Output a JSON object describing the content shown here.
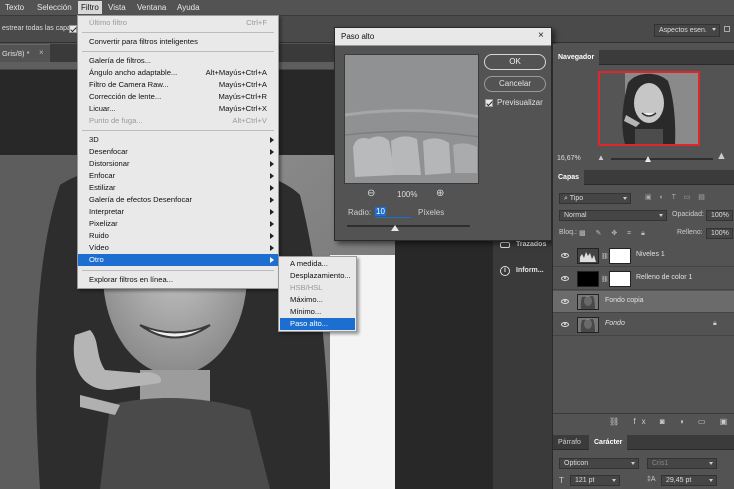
{
  "menubar": {
    "items": [
      "Texto",
      "Selección",
      "Filtro",
      "Vista",
      "Ventana",
      "Ayuda"
    ]
  },
  "options_bar": {
    "sample_all_layers": "estrear todas las capas",
    "workspace": "Aspectos esen."
  },
  "document_tab": "Gris/8) *",
  "filter_menu": {
    "items": [
      {
        "label": "Último filtro",
        "shortcut": "Ctrl+F",
        "disabled": true
      },
      {
        "label": "Convertir para filtros inteligentes",
        "shortcut": ""
      },
      {
        "label": "Galería de filtros...",
        "shortcut": ""
      },
      {
        "label": "Ángulo ancho adaptable...",
        "shortcut": "Alt+Mayús+Ctrl+A"
      },
      {
        "label": "Filtro de Camera Raw...",
        "shortcut": "Mayús+Ctrl+A"
      },
      {
        "label": "Corrección de lente...",
        "shortcut": "Mayús+Ctrl+R"
      },
      {
        "label": "Licuar...",
        "shortcut": "Mayús+Ctrl+X"
      },
      {
        "label": "Punto de fuga...",
        "shortcut": "Alt+Ctrl+V",
        "disabled": true
      },
      {
        "label": "3D"
      },
      {
        "label": "Desenfocar"
      },
      {
        "label": "Distorsionar"
      },
      {
        "label": "Enfocar"
      },
      {
        "label": "Estilizar"
      },
      {
        "label": "Galería de efectos Desenfocar"
      },
      {
        "label": "Interpretar"
      },
      {
        "label": "Pixelizar"
      },
      {
        "label": "Ruido"
      },
      {
        "label": "Vídeo"
      },
      {
        "label": "Otro"
      },
      {
        "label": "Explorar filtros en línea..."
      }
    ]
  },
  "submenu_otro": {
    "items": [
      {
        "label": "A medida..."
      },
      {
        "label": "Desplazamiento..."
      },
      {
        "label": "HSB/HSL",
        "disabled": true
      },
      {
        "label": "Máximo..."
      },
      {
        "label": "Mínimo..."
      },
      {
        "label": "Paso alto..."
      }
    ]
  },
  "high_pass_dialog": {
    "title": "Paso alto",
    "ok": "OK",
    "cancel": "Cancelar",
    "preview_label": "Previsualizar",
    "preview_checked": true,
    "zoom": "100%",
    "radius_label": "Radio:",
    "radius_value": "10",
    "radius_unit": "Píxeles"
  },
  "dock": {
    "items": [
      "Trazados",
      "Inform..."
    ]
  },
  "navigator": {
    "tab": "Navegador",
    "zoom": "16,67%"
  },
  "layers": {
    "tab": "Capas",
    "filter_kind": "Tipo",
    "blend_mode": "Normal",
    "opacity_label": "Opacidad:",
    "opacity_value": "100%",
    "lock_label": "Bloq.:",
    "fill_label": "Relleno:",
    "fill_value": "100%",
    "items": [
      {
        "name": "Niveles 1"
      },
      {
        "name": "Relleno de color 1"
      },
      {
        "name": "Fondo copia"
      },
      {
        "name": "Fondo"
      }
    ]
  },
  "character": {
    "tabs": [
      "Párrafo",
      "Carácter"
    ],
    "font_family": "Opticon",
    "font_style": "Cris1",
    "size": "121 pt",
    "leading": "29,45 pt"
  },
  "colors": {
    "highlight": "#1c6fd0",
    "panel_bg": "#535353",
    "menu_bg": "#e9e9e9",
    "navigator_frame": "#e0252b"
  }
}
